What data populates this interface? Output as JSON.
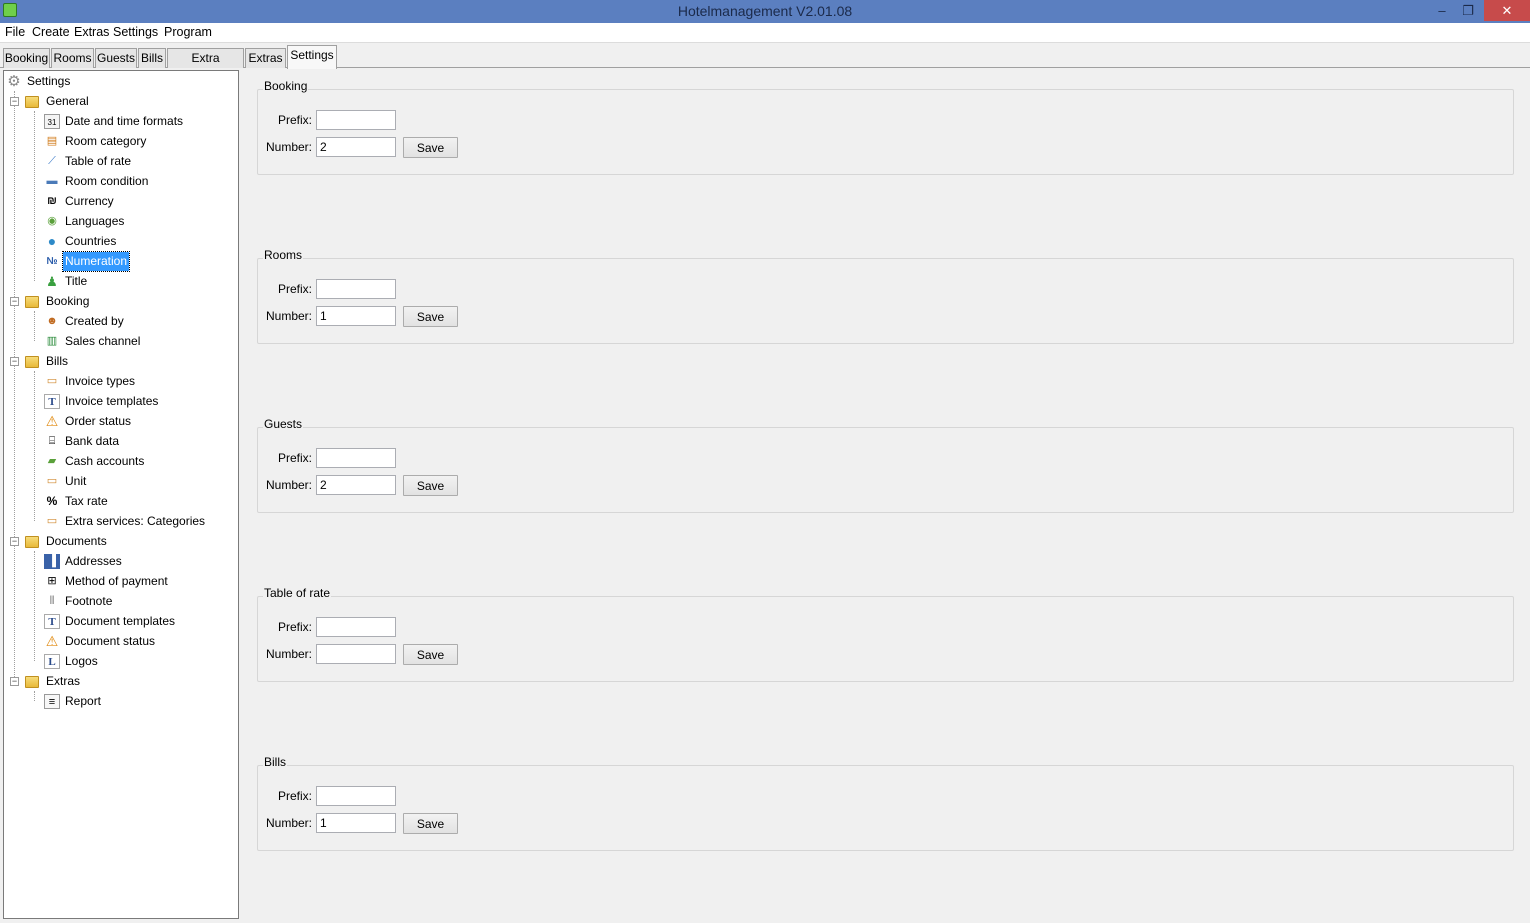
{
  "window": {
    "title": "Hotelmanagement V2.01.08",
    "minimize": "–",
    "restore": "❐",
    "close": "✕"
  },
  "menu": [
    "File",
    "Create",
    "Extras",
    "Settings",
    "Program"
  ],
  "tabs": [
    "Booking",
    "Rooms",
    "Guests",
    "Bills",
    "Extra services",
    "Extras",
    "Settings"
  ],
  "active_tab": "Settings",
  "tree": {
    "root": "Settings",
    "general": {
      "label": "General",
      "items": [
        "Date and time formats",
        "Room category",
        "Table of rate",
        "Room condition",
        "Currency",
        "Languages",
        "Countries",
        "Numeration",
        "Title"
      ]
    },
    "booking": {
      "label": "Booking",
      "items": [
        "Created by",
        "Sales channel"
      ]
    },
    "bills": {
      "label": "Bills",
      "items": [
        "Invoice types",
        "Invoice templates",
        "Order status",
        "Bank data",
        "Cash accounts",
        "Unit",
        "Tax rate",
        "Extra services: Categories"
      ]
    },
    "documents": {
      "label": "Documents",
      "items": [
        "Addresses",
        "Method of payment",
        "Footnote",
        "Document templates",
        "Document status",
        "Logos"
      ]
    },
    "extras": {
      "label": "Extras",
      "items": [
        "Report"
      ]
    },
    "selected": "Numeration"
  },
  "labels": {
    "prefix": "Prefix:",
    "number": "Number:",
    "save": "Save"
  },
  "groups": [
    {
      "title": "Booking",
      "prefix": "",
      "number": "2"
    },
    {
      "title": "Rooms",
      "prefix": "",
      "number": "1"
    },
    {
      "title": "Guests",
      "prefix": "",
      "number": "2"
    },
    {
      "title": "Table of rate",
      "prefix": "",
      "number": ""
    },
    {
      "title": "Bills",
      "prefix": "",
      "number": "1"
    }
  ],
  "colors": {
    "titlebar": "#5b7fc0",
    "selection": "#3399ff",
    "close": "#c74b4b"
  }
}
